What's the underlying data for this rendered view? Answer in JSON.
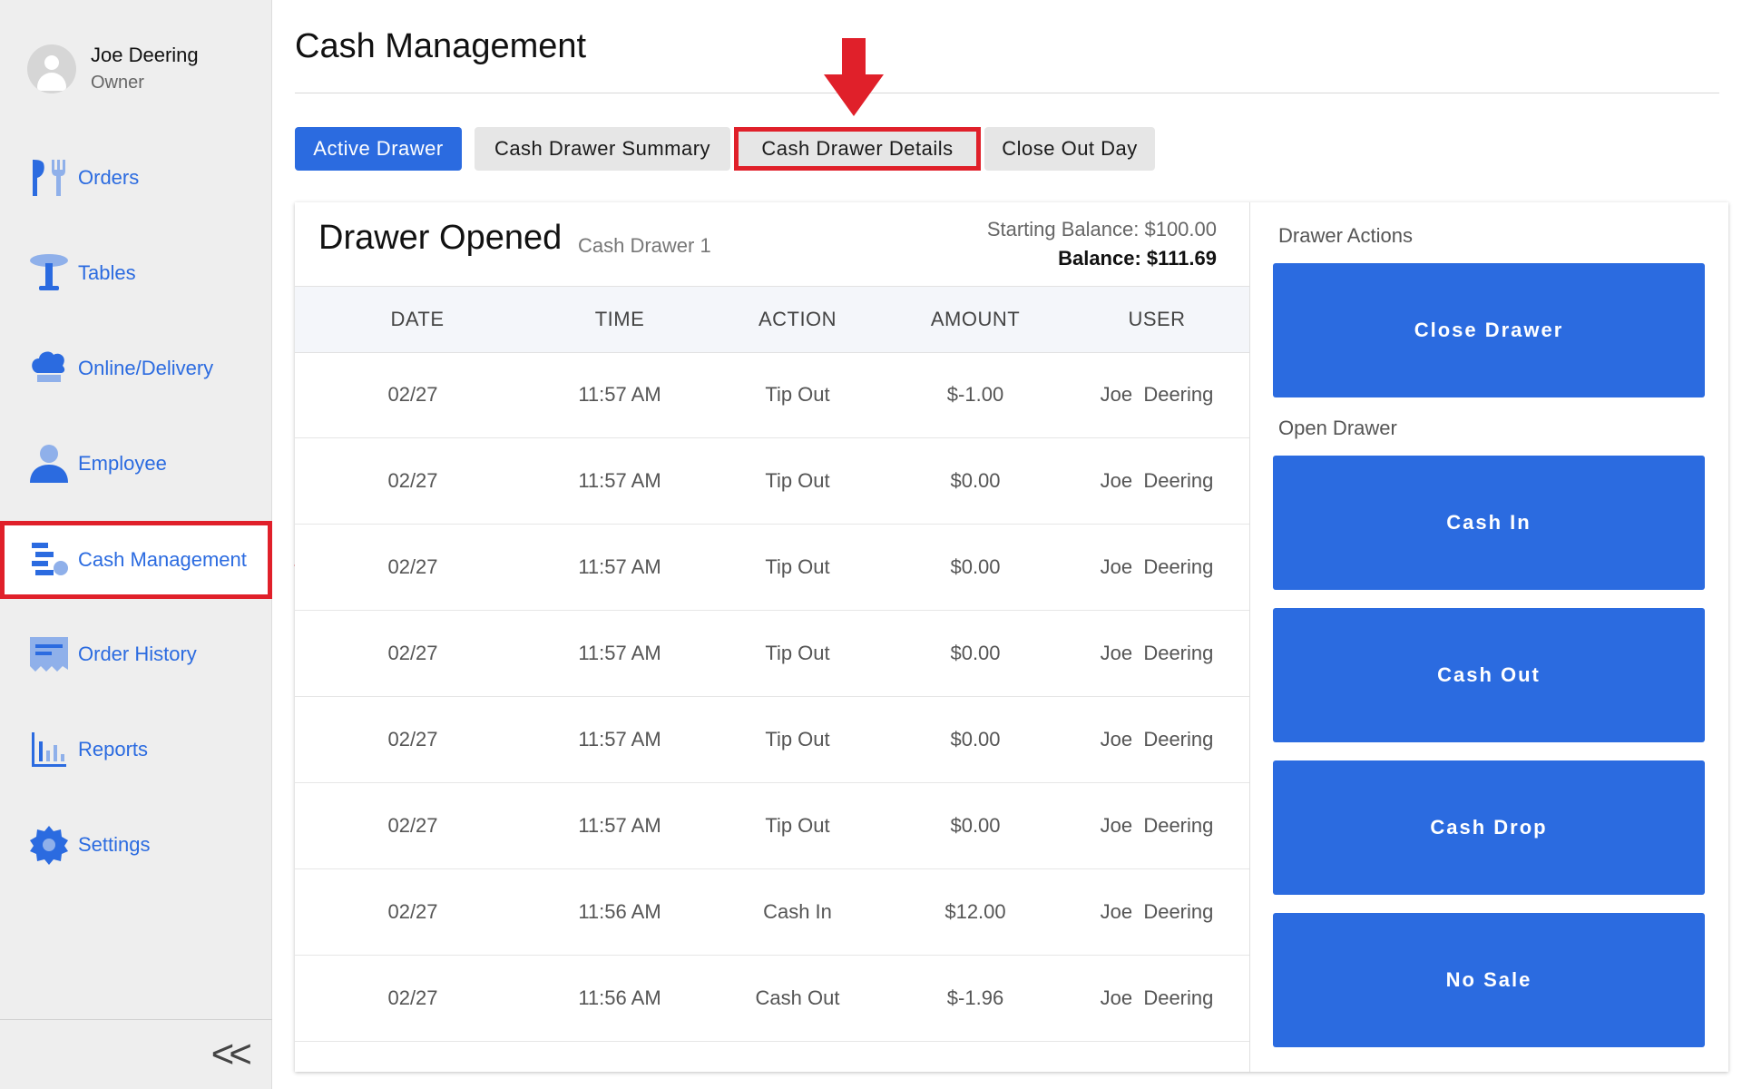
{
  "user": {
    "name": "Joe Deering",
    "role": "Owner"
  },
  "sidebar": {
    "items": [
      {
        "label": "Orders",
        "icon": "fork-utensils-icon"
      },
      {
        "label": "Tables",
        "icon": "table-icon"
      },
      {
        "label": "Online/Delivery",
        "icon": "chef-hat-icon"
      },
      {
        "label": "Employee",
        "icon": "person-icon"
      },
      {
        "label": "Cash Management",
        "icon": "cash-management-icon",
        "active": true
      },
      {
        "label": "Order History",
        "icon": "receipt-icon"
      },
      {
        "label": "Reports",
        "icon": "bar-chart-icon"
      },
      {
        "label": "Settings",
        "icon": "gear-icon"
      }
    ],
    "collapse_label": "<<"
  },
  "page": {
    "title": "Cash Management"
  },
  "tabs": [
    {
      "label": "Active Drawer",
      "active": true
    },
    {
      "label": "Cash Drawer Summary"
    },
    {
      "label": "Cash Drawer Details",
      "highlighted": true
    },
    {
      "label": "Close Out Day"
    }
  ],
  "drawer": {
    "status": "Drawer Opened",
    "name": "Cash Drawer 1",
    "starting_balance": "Starting Balance: $100.00",
    "balance": "Balance: $111.69"
  },
  "table": {
    "columns": [
      "DATE",
      "TIME",
      "ACTION",
      "AMOUNT",
      "USER"
    ],
    "rows": [
      {
        "date": "02/27",
        "time": "11:57 AM",
        "action": "Tip Out",
        "amount": "$-1.00",
        "user": "Joe  Deering"
      },
      {
        "date": "02/27",
        "time": "11:57 AM",
        "action": "Tip Out",
        "amount": "$0.00",
        "user": "Joe  Deering"
      },
      {
        "date": "02/27",
        "time": "11:57 AM",
        "action": "Tip Out",
        "amount": "$0.00",
        "user": "Joe  Deering"
      },
      {
        "date": "02/27",
        "time": "11:57 AM",
        "action": "Tip Out",
        "amount": "$0.00",
        "user": "Joe  Deering"
      },
      {
        "date": "02/27",
        "time": "11:57 AM",
        "action": "Tip Out",
        "amount": "$0.00",
        "user": "Joe  Deering"
      },
      {
        "date": "02/27",
        "time": "11:57 AM",
        "action": "Tip Out",
        "amount": "$0.00",
        "user": "Joe  Deering"
      },
      {
        "date": "02/27",
        "time": "11:56 AM",
        "action": "Cash In",
        "amount": "$12.00",
        "user": "Joe  Deering"
      },
      {
        "date": "02/27",
        "time": "11:56 AM",
        "action": "Cash Out",
        "amount": "$-1.96",
        "user": "Joe  Deering"
      }
    ]
  },
  "actions": {
    "drawer_actions_label": "Drawer Actions",
    "close_drawer": "Close Drawer",
    "open_drawer_label": "Open Drawer",
    "cash_in": "Cash In",
    "cash_out": "Cash Out",
    "cash_drop": "Cash Drop",
    "no_sale": "No Sale"
  },
  "colors": {
    "accent": "#2b6be0",
    "highlight": "#e0202a",
    "sidebar_bg": "#eeeeee"
  }
}
